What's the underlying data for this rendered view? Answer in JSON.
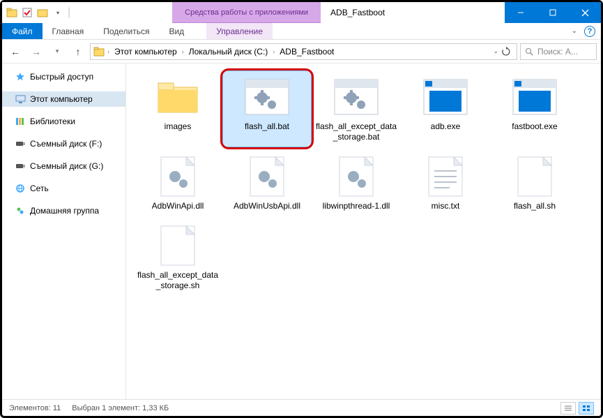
{
  "titlebar": {
    "tools_tab": "Средства работы с приложениями",
    "title": "ADB_Fastboot"
  },
  "ribbon": {
    "file": "Файл",
    "home": "Главная",
    "share": "Поделиться",
    "view": "Вид",
    "manage": "Управление"
  },
  "breadcrumb": {
    "items": [
      "Этот компьютер",
      "Локальный диск (C:)",
      "ADB_Fastboot"
    ]
  },
  "search": {
    "placeholder": "Поиск: A..."
  },
  "nav": {
    "quick_access": "Быстрый доступ",
    "this_pc": "Этот компьютер",
    "libraries": "Библиотеки",
    "drive_f": "Съемный диск (F:)",
    "drive_g": "Съемный диск (G:)",
    "network": "Сеть",
    "homegroup": "Домашняя группа"
  },
  "files": [
    {
      "name": "images",
      "type": "folder",
      "highlight": false,
      "selected": false
    },
    {
      "name": "flash_all.bat",
      "type": "bat",
      "highlight": true,
      "selected": true
    },
    {
      "name": "flash_all_except_data_storage.bat",
      "type": "bat",
      "highlight": false,
      "selected": false
    },
    {
      "name": "adb.exe",
      "type": "exe",
      "highlight": false,
      "selected": false
    },
    {
      "name": "fastboot.exe",
      "type": "exe",
      "highlight": false,
      "selected": false
    },
    {
      "name": "AdbWinApi.dll",
      "type": "dll",
      "highlight": false,
      "selected": false
    },
    {
      "name": "AdbWinUsbApi.dll",
      "type": "dll",
      "highlight": false,
      "selected": false
    },
    {
      "name": "libwinpthread-1.dll",
      "type": "dll",
      "highlight": false,
      "selected": false
    },
    {
      "name": "misc.txt",
      "type": "txt",
      "highlight": false,
      "selected": false
    },
    {
      "name": "flash_all.sh",
      "type": "sh",
      "highlight": false,
      "selected": false
    },
    {
      "name": "flash_all_except_data_storage.sh",
      "type": "sh",
      "highlight": false,
      "selected": false
    }
  ],
  "status": {
    "count": "Элементов: 11",
    "selection": "Выбран 1 элемент: 1,33 КБ"
  }
}
